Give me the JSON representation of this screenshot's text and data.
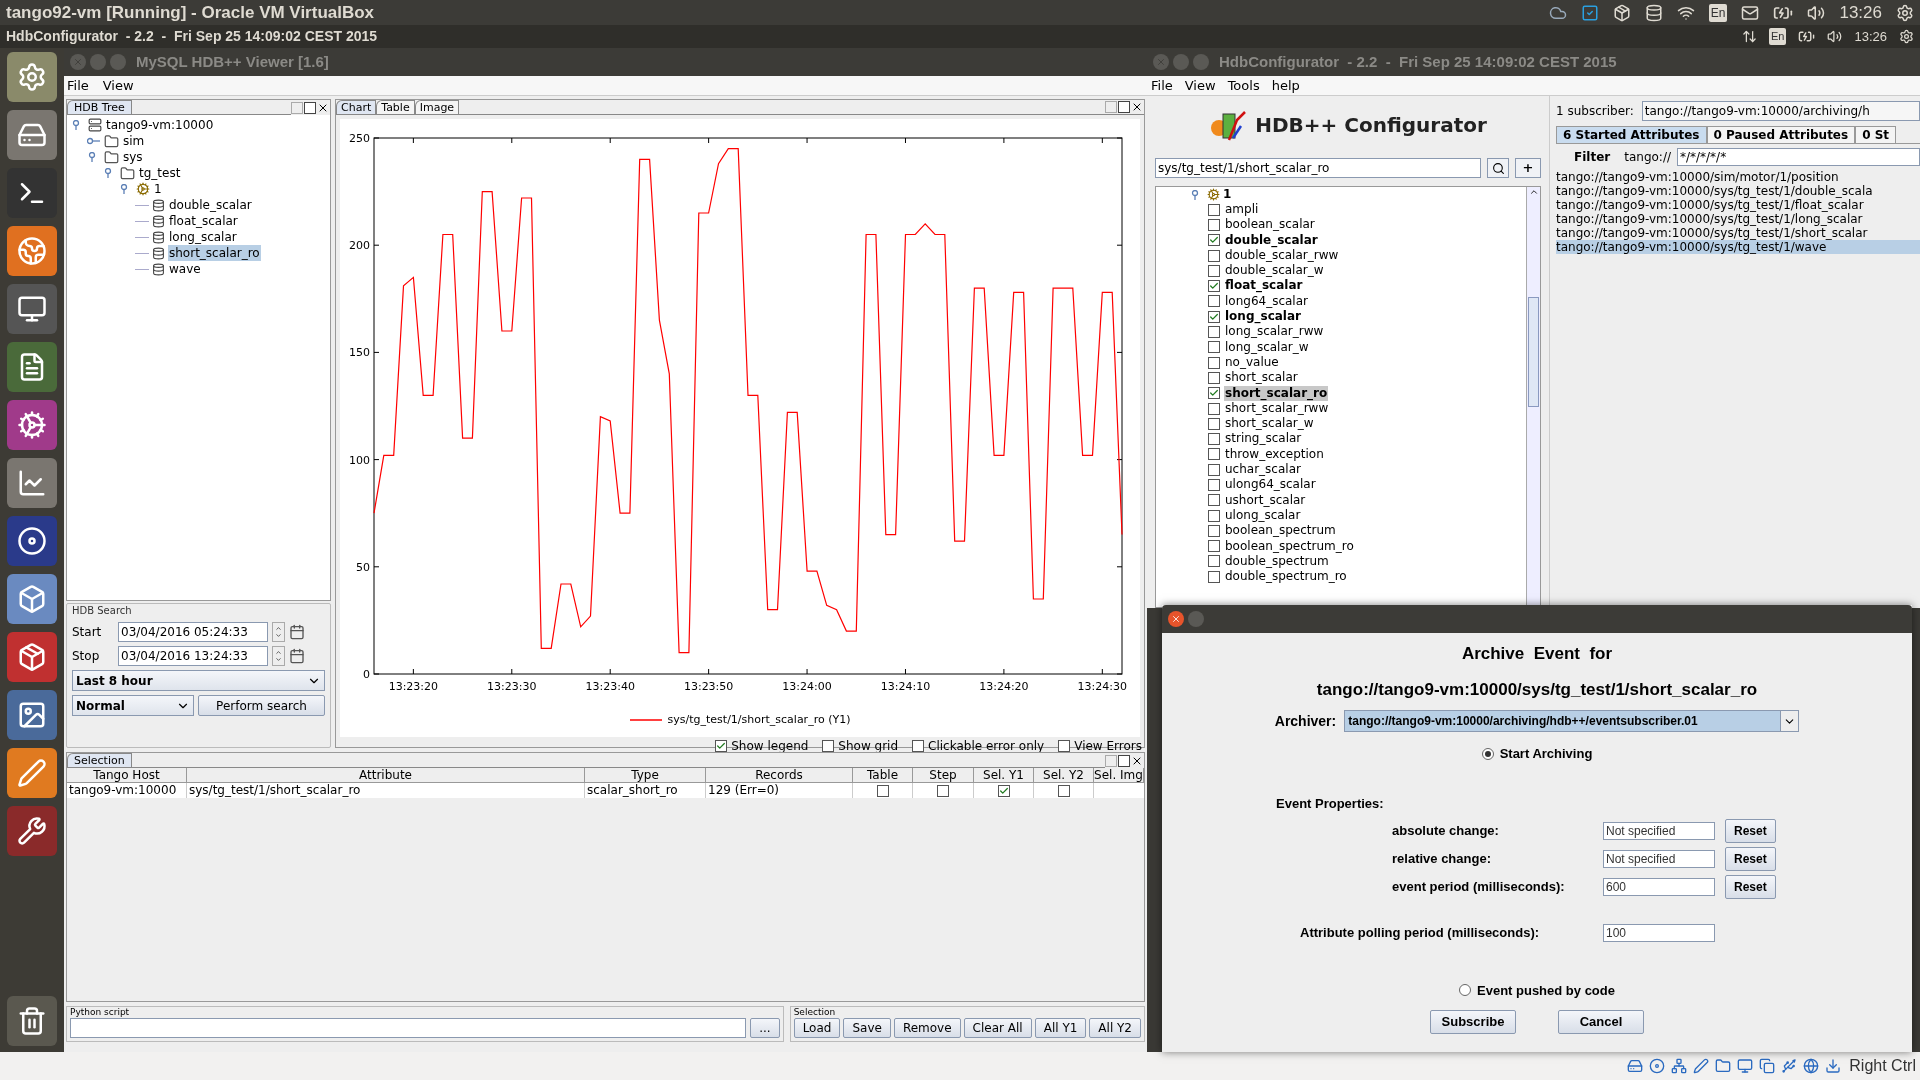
{
  "vm_window": {
    "title": "tango92-vm [Running] - Oracle VM VirtualBox",
    "lang": "En",
    "time": "13:26"
  },
  "guest_panel": {
    "title": "HdbConfigurator  - 2.2  -  Fri Sep 25 14:09:02 CEST 2015",
    "lang": "En",
    "time": "13:26"
  },
  "viewer": {
    "title": "MySQL HDB++ Viewer [1.6]",
    "menu": [
      "File",
      "View"
    ],
    "tree_tab": "HDB Tree",
    "tree": [
      {
        "label": "tango9-vm:10000",
        "kind": "host",
        "expanded": true,
        "children": [
          {
            "label": "sim",
            "kind": "folder",
            "expanded": false
          },
          {
            "label": "sys",
            "kind": "folder",
            "expanded": true,
            "children": [
              {
                "label": "tg_test",
                "kind": "folder",
                "expanded": true,
                "children": [
                  {
                    "label": "1",
                    "kind": "device",
                    "expanded": true,
                    "children": [
                      {
                        "label": "double_scalar",
                        "kind": "attribute",
                        "selected": false
                      },
                      {
                        "label": "float_scalar",
                        "kind": "attribute",
                        "selected": false
                      },
                      {
                        "label": "long_scalar",
                        "kind": "attribute",
                        "selected": false
                      },
                      {
                        "label": "short_scalar_ro",
                        "kind": "attribute",
                        "selected": true
                      },
                      {
                        "label": "wave",
                        "kind": "attribute",
                        "selected": false
                      }
                    ]
                  }
                ]
              }
            ]
          }
        ]
      }
    ],
    "search": {
      "title": "HDB Search",
      "start_label": "Start",
      "start": "03/04/2016 05:24:33",
      "stop_label": "Stop",
      "stop": "03/04/2016 13:24:33",
      "range": "Last 8 hour",
      "mode": "Normal",
      "button": "Perform search"
    },
    "chart_tabs": [
      {
        "label": "Chart",
        "selected": true
      },
      {
        "label": "Table",
        "selected": false
      },
      {
        "label": "Image",
        "selected": false
      }
    ],
    "chart": {
      "chart_data": {
        "type": "line",
        "x": [
          48196,
          48197,
          48198,
          48199,
          48200,
          48201,
          48202,
          48203,
          48204,
          48205,
          48206,
          48207,
          48208,
          48209,
          48210,
          48211,
          48212,
          48213,
          48214,
          48215,
          48216,
          48217,
          48218,
          48219,
          48220,
          48221,
          48222,
          48223,
          48224,
          48225,
          48226,
          48227,
          48228,
          48229,
          48230,
          48231,
          48232,
          48233,
          48234,
          48235,
          48236,
          48237,
          48238,
          48239,
          48240,
          48241,
          48242,
          48243,
          48244,
          48245,
          48246,
          48247,
          48248,
          48249,
          48250,
          48251,
          48252,
          48253,
          48254,
          48255,
          48256,
          48257,
          48258,
          48259,
          48260,
          48261,
          48262,
          48263,
          48264,
          48265,
          48266,
          48267,
          48268,
          48269,
          48270,
          48271,
          48272
        ],
        "series": [
          {
            "name": "sys/tg_test/1/short_scalar_ro (Y1)",
            "color": "#ff0000",
            "values": [
              75,
              102,
              102,
              181,
              185,
              130,
              130,
              205,
              205,
              110,
              110,
              225,
              225,
              160,
              160,
              222,
              222,
              12,
              12,
              42,
              42,
              22,
              27,
              120,
              118,
              75,
              75,
              240,
              240,
              165,
              140,
              10,
              10,
              215,
              215,
              238,
              245,
              245,
              130,
              130,
              30,
              30,
              122,
              122,
              48,
              48,
              32,
              30,
              20,
              20,
              205,
              205,
              65,
              65,
              205,
              205,
              210,
              205,
              205,
              62,
              62,
              180,
              180,
              102,
              102,
              178,
              178,
              35,
              35,
              180,
              180,
              180,
              102,
              102,
              178,
              178,
              65
            ]
          }
        ],
        "xlim": [
          48196,
          48272
        ],
        "ylim": [
          0,
          250
        ],
        "xticks": [
          {
            "value": 48200,
            "label": "13:23:20"
          },
          {
            "value": 48210,
            "label": "13:23:30"
          },
          {
            "value": 48220,
            "label": "13:23:40"
          },
          {
            "value": 48230,
            "label": "13:23:50"
          },
          {
            "value": 48240,
            "label": "13:24:00"
          },
          {
            "value": 48250,
            "label": "13:24:10"
          },
          {
            "value": 48260,
            "label": "13:24:20"
          },
          {
            "value": 48270,
            "label": "13:24:30"
          }
        ],
        "yticks": [
          0,
          50,
          100,
          150,
          200,
          250
        ]
      }
    },
    "chart_options": [
      {
        "label": "Show legend",
        "checked": true
      },
      {
        "label": "Show grid",
        "checked": false
      },
      {
        "label": "Clickable error only",
        "checked": false
      },
      {
        "label": "View Errors",
        "checked": false
      }
    ],
    "selection_tab": "Selection",
    "selection_columns": [
      "Tango Host",
      "Attribute",
      "Type",
      "Records",
      "Table",
      "Step",
      "Sel. Y1",
      "Sel. Y2",
      "Sel. Img"
    ],
    "selection_rows": [
      {
        "cells": [
          "tango9-vm:10000",
          "sys/tg_test/1/short_scalar_ro",
          "scalar_short_ro",
          "129 (Err=0)"
        ],
        "checks": [
          false,
          false,
          true,
          false
        ]
      }
    ],
    "python_title": "Python script",
    "browse": "...",
    "selection_title": "Selection",
    "selection_buttons": [
      "Load",
      "Save",
      "Remove",
      "Clear All",
      "All Y1",
      "All Y2"
    ]
  },
  "configurator": {
    "title": "HdbConfigurator  - 2.2  -  Fri Sep 25 14:09:02 CEST 2015",
    "menu": [
      "File",
      "View",
      "Tools",
      "help"
    ],
    "heading": "HDB++ Configurator",
    "search": "sys/tg_test/1/short_scalar_ro",
    "add": "+",
    "device": "1",
    "attributes": [
      {
        "label": "ampli",
        "checked": false,
        "selected": false
      },
      {
        "label": "boolean_scalar",
        "checked": false,
        "selected": false
      },
      {
        "label": "double_scalar",
        "checked": true,
        "selected": false
      },
      {
        "label": "double_scalar_rww",
        "checked": false,
        "selected": false
      },
      {
        "label": "double_scalar_w",
        "checked": false,
        "selected": false
      },
      {
        "label": "float_scalar",
        "checked": true,
        "selected": false
      },
      {
        "label": "long64_scalar",
        "checked": false,
        "selected": false
      },
      {
        "label": "long_scalar",
        "checked": true,
        "selected": false
      },
      {
        "label": "long_scalar_rww",
        "checked": false,
        "selected": false
      },
      {
        "label": "long_scalar_w",
        "checked": false,
        "selected": false
      },
      {
        "label": "no_value",
        "checked": false,
        "selected": false
      },
      {
        "label": "short_scalar",
        "checked": false,
        "selected": false
      },
      {
        "label": "short_scalar_ro",
        "checked": true,
        "selected": true
      },
      {
        "label": "short_scalar_rww",
        "checked": false,
        "selected": false
      },
      {
        "label": "short_scalar_w",
        "checked": false,
        "selected": false
      },
      {
        "label": "string_scalar",
        "checked": false,
        "selected": false
      },
      {
        "label": "throw_exception",
        "checked": false,
        "selected": false
      },
      {
        "label": "uchar_scalar",
        "checked": false,
        "selected": false
      },
      {
        "label": "ulong64_scalar",
        "checked": false,
        "selected": false
      },
      {
        "label": "ushort_scalar",
        "checked": false,
        "selected": false
      },
      {
        "label": "ulong_scalar",
        "checked": false,
        "selected": false
      },
      {
        "label": "boolean_spectrum",
        "checked": false,
        "selected": false
      },
      {
        "label": "boolean_spectrum_ro",
        "checked": false,
        "selected": false
      },
      {
        "label": "double_spectrum",
        "checked": false,
        "selected": false
      },
      {
        "label": "double_spectrum_ro",
        "checked": false,
        "selected": false
      }
    ],
    "subscriber_label": "1 subscriber:",
    "subscriber": "tango://tango9-vm:10000/archiving/h",
    "tabs": [
      {
        "label": "6 Started Attributes",
        "selected": true
      },
      {
        "label": "0 Paused Attributes",
        "selected": false
      },
      {
        "label": "0 St",
        "selected": false
      }
    ],
    "filter_label": "Filter",
    "filter_prefix": "tango://",
    "filter": "*/*/*/*/*",
    "started": [
      {
        "label": "tango://tango9-vm:10000/sim/motor/1/position",
        "selected": false
      },
      {
        "label": "tango://tango9-vm:10000/sys/tg_test/1/double_scala",
        "selected": false
      },
      {
        "label": "tango://tango9-vm:10000/sys/tg_test/1/float_scalar",
        "selected": false
      },
      {
        "label": "tango://tango9-vm:10000/sys/tg_test/1/long_scalar",
        "selected": false
      },
      {
        "label": "tango://tango9-vm:10000/sys/tg_test/1/short_scalar",
        "selected": false
      },
      {
        "label": "tango://tango9-vm:10000/sys/tg_test/1/wave",
        "selected": true
      }
    ]
  },
  "dialog": {
    "title_line1": "Archive  Event  for",
    "title_line2": "tango://tango9-vm:10000/sys/tg_test/1/short_scalar_ro",
    "archiver_label": "Archiver:",
    "archiver": "tango://tango9-vm:10000/archiving/hdb++/eventsubscriber.01",
    "modes": [
      {
        "label": "Start Archiving",
        "selected": true
      },
      {
        "label": "Event pushed by code",
        "selected": false
      }
    ],
    "properties_title": "Event Properties:",
    "properties": [
      {
        "label": "absolute change:",
        "value": "Not specified",
        "reset": "Reset"
      },
      {
        "label": "relative change:",
        "value": "Not specified",
        "reset": "Reset"
      },
      {
        "label": "event period (milliseconds):",
        "value": "600",
        "reset": "Reset"
      }
    ],
    "polling_label": "Attribute polling period (milliseconds):",
    "polling": "100",
    "buttons": [
      "Subscribe",
      "Cancel"
    ]
  },
  "status_bar": {
    "host_key": "Right Ctrl"
  }
}
